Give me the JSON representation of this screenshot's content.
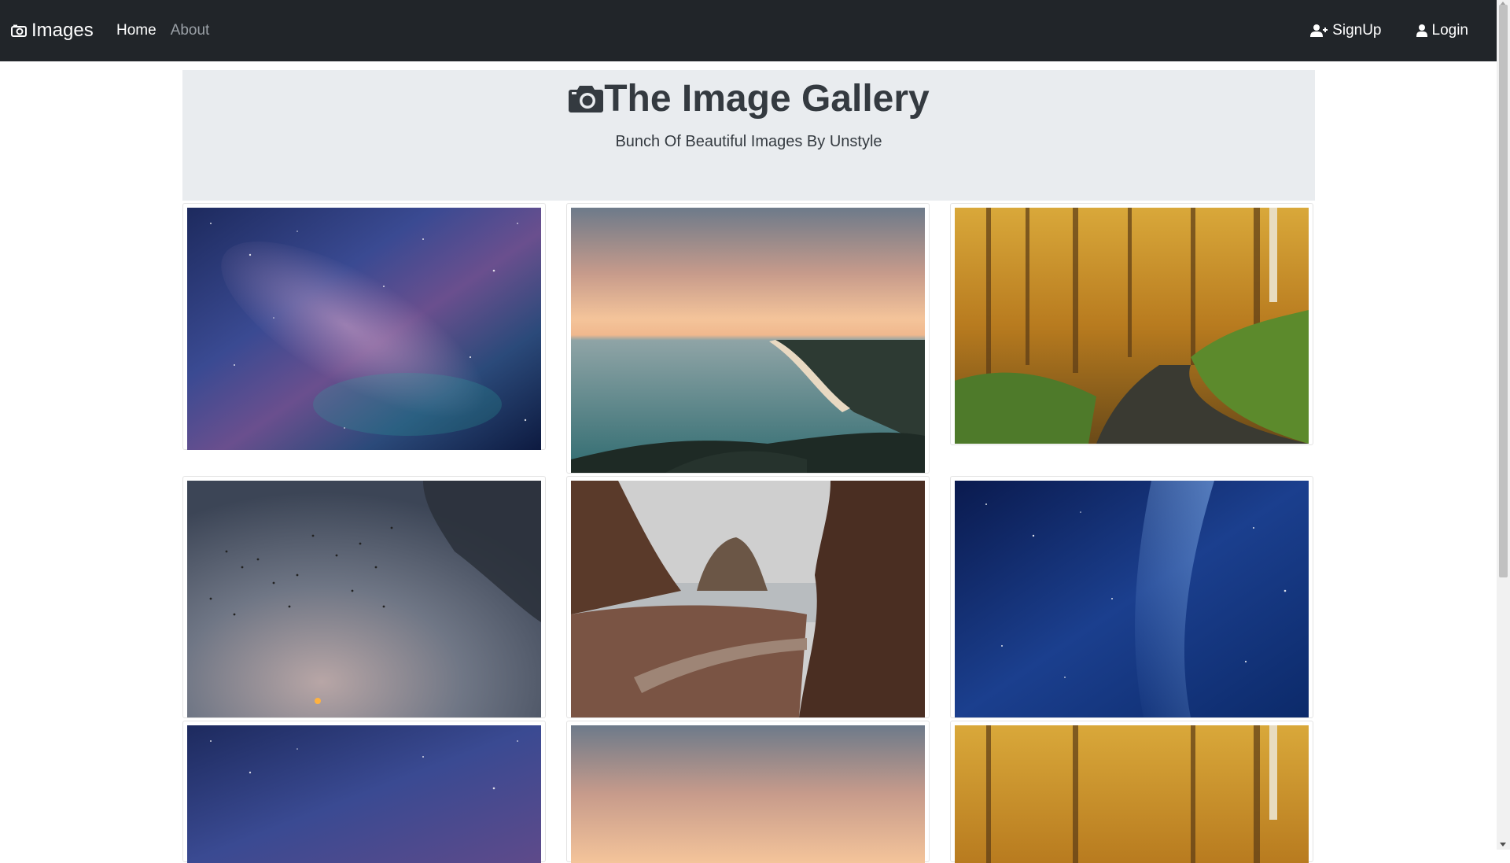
{
  "navbar": {
    "brand": "Images",
    "brand_icon": "camera-icon",
    "links": [
      {
        "label": "Home"
      },
      {
        "label": "About"
      }
    ],
    "signup_label": "SignUp",
    "signup_icon": "user-plus-icon",
    "login_label": "Login",
    "login_icon": "user-icon"
  },
  "hero": {
    "title": "The Image Gallery",
    "title_icon": "camera-icon",
    "subtitle": "Bunch Of Beautiful Images By Unstyle"
  },
  "gallery": {
    "images": [
      {
        "scene": "galaxy-night-sky"
      },
      {
        "scene": "coastal-sunset"
      },
      {
        "scene": "autumn-forest-path"
      },
      {
        "scene": "birds-misty-sky"
      },
      {
        "scene": "sea-stack-beach"
      },
      {
        "scene": "blue-milky-way"
      },
      {
        "scene": "galaxy-night-sky"
      },
      {
        "scene": "coastal-sunset"
      },
      {
        "scene": "autumn-forest-path"
      }
    ]
  },
  "colors": {
    "navbar_bg": "#212529",
    "hero_bg": "#e9ecef",
    "text_dark": "#343a40"
  }
}
